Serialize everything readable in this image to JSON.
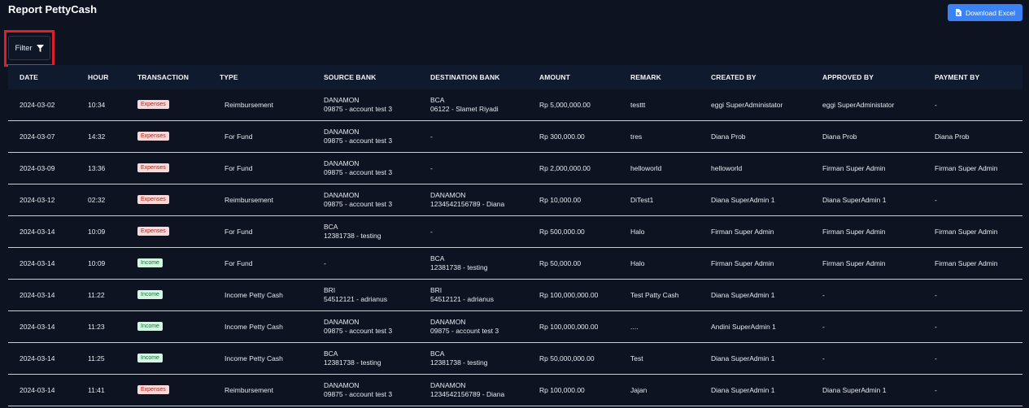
{
  "title": "Report PettyCash",
  "export_button": {
    "label": "Download Excel",
    "icon": "file-excel-icon"
  },
  "filter": {
    "label": "Filter",
    "icon": "filter-icon",
    "highlight_color": "#e11d2a"
  },
  "colors": {
    "background": "#0d1321",
    "accent": "#3b82f6",
    "expenses_badge_bg": "#fcd9d9",
    "income_badge_bg": "#d3f7e0"
  },
  "columns": [
    "DATE",
    "HOUR",
    "TRANSACTION",
    "TYPE",
    "SOURCE BANK",
    "DESTINATION BANK",
    "AMOUNT",
    "REMARK",
    "CREATED BY",
    "APPROVED BY",
    "PAYMENT BY"
  ],
  "rows": [
    {
      "date": "2024-03-02",
      "hour": "10:34",
      "transaction": "Expenses",
      "type": "Reimbursement",
      "source": [
        "DANAMON",
        "09875 - account test 3"
      ],
      "dest": [
        "BCA",
        "06122 - Slamet Riyadi"
      ],
      "amount": "Rp 5,000,000.00",
      "remark": "testtt",
      "created": "eggi SuperAdministator",
      "approved": "eggi SuperAdministator",
      "payment": "-"
    },
    {
      "date": "2024-03-07",
      "hour": "14:32",
      "transaction": "Expenses",
      "type": "For Fund",
      "source": [
        "DANAMON",
        "09875 - account test 3"
      ],
      "dest": [
        "-"
      ],
      "amount": "Rp 300,000.00",
      "remark": "tres",
      "created": "Diana Prob",
      "approved": "Diana Prob",
      "payment": "Diana Prob"
    },
    {
      "date": "2024-03-09",
      "hour": "13:36",
      "transaction": "Expenses",
      "type": "For Fund",
      "source": [
        "DANAMON",
        "09875 - account test 3"
      ],
      "dest": [
        "-"
      ],
      "amount": "Rp 2,000,000.00",
      "remark": "helloworld",
      "created": "helloworld",
      "approved": "Firman Super Admin",
      "payment": "Firman Super Admin"
    },
    {
      "date": "2024-03-12",
      "hour": "02:32",
      "transaction": "Expenses",
      "type": "Reimbursement",
      "source": [
        "DANAMON",
        "09875 - account test 3"
      ],
      "dest": [
        "DANAMON",
        "1234542156789 - Diana"
      ],
      "amount": "Rp 10,000.00",
      "remark": "DiTest1",
      "created": "Diana SuperAdmin 1",
      "approved": "Diana SuperAdmin 1",
      "payment": "-"
    },
    {
      "date": "2024-03-14",
      "hour": "10:09",
      "transaction": "Expenses",
      "type": "For Fund",
      "source": [
        "BCA",
        "12381738 - testing"
      ],
      "dest": [
        "-"
      ],
      "amount": "Rp 500,000.00",
      "remark": "Halo",
      "created": "Firman Super Admin",
      "approved": "Firman Super Admin",
      "payment": "Firman Super Admin"
    },
    {
      "date": "2024-03-14",
      "hour": "10:09",
      "transaction": "Income",
      "type": "For Fund",
      "source": [
        "-"
      ],
      "dest": [
        "BCA",
        "12381738 - testing"
      ],
      "amount": "Rp 50,000.00",
      "remark": "Halo",
      "created": "Firman Super Admin",
      "approved": "Firman Super Admin",
      "payment": "Firman Super Admin"
    },
    {
      "date": "2024-03-14",
      "hour": "11:22",
      "transaction": "Income",
      "type": "Income Petty Cash",
      "source": [
        "BRI",
        "54512121 - adrianus"
      ],
      "dest": [
        "BRI",
        "54512121 - adrianus"
      ],
      "amount": "Rp 100,000,000.00",
      "remark": "Test Patty Cash",
      "created": "Diana SuperAdmin 1",
      "approved": "-",
      "payment": "-"
    },
    {
      "date": "2024-03-14",
      "hour": "11:23",
      "transaction": "Income",
      "type": "Income Petty Cash",
      "source": [
        "DANAMON",
        "09875 - account test 3"
      ],
      "dest": [
        "DANAMON",
        "09875 - account test 3"
      ],
      "amount": "Rp 100,000,000.00",
      "remark": "....",
      "created": "Andini SuperAdmin 1",
      "approved": "-",
      "payment": "-"
    },
    {
      "date": "2024-03-14",
      "hour": "11:25",
      "transaction": "Income",
      "type": "Income Petty Cash",
      "source": [
        "BCA",
        "12381738 - testing"
      ],
      "dest": [
        "BCA",
        "12381738 - testing"
      ],
      "amount": "Rp 50,000,000.00",
      "remark": "Test",
      "created": "Diana SuperAdmin 1",
      "approved": "-",
      "payment": "-"
    },
    {
      "date": "2024-03-14",
      "hour": "11:41",
      "transaction": "Expenses",
      "type": "Reimbursement",
      "source": [
        "DANAMON",
        "09875 - account test 3"
      ],
      "dest": [
        "DANAMON",
        "1234542156789 - Diana"
      ],
      "amount": "Rp 100,000.00",
      "remark": "Jajan",
      "created": "Diana SuperAdmin 1",
      "approved": "Diana SuperAdmin 1",
      "payment": "-"
    }
  ]
}
